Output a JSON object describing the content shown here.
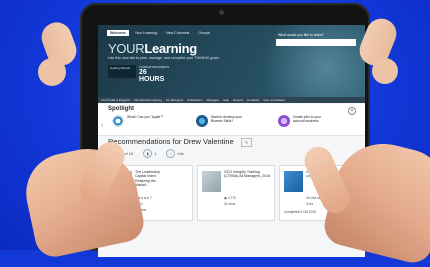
{
  "nav_tabs": [
    "Welcome",
    "Your Learning",
    "New Channels",
    "Groups"
  ],
  "logo_prefix": "YOUR",
  "logo_suffix": "Learning",
  "tagline": "Use this new site to plan, manage, and complete your THINK40 goals.",
  "stat_box": "Getting Started",
  "stat_label": "THINK40 PROGRESS",
  "stat_value": "26 HOURS",
  "search_label": "What would you like to learn?",
  "search_placeholder": "",
  "subnav": [
    "Your Profile & Progress",
    "Self-Directed Learning",
    "For Managers",
    "Notifications",
    "Messages",
    "Help",
    "Mentors",
    "Feedback",
    "Give us feedback"
  ],
  "spotlight": {
    "title": "Spotlight",
    "items": [
      {
        "text": "What? Can you \"Apple\"?"
      },
      {
        "text": "Want to develop your Bluemix Skills?"
      },
      {
        "text": "Create jobs to your account business"
      }
    ]
  },
  "recommendations_title": "Recommendations for Drew Valentine",
  "reco_edit": "✎",
  "filters": [
    {
      "icon": "✓",
      "label": "1 of 10"
    },
    {
      "icon": "▮",
      "label": "1"
    },
    {
      "icon": "i",
      "label": "Info"
    }
  ],
  "cards": [
    {
      "title": "The Leadership Capital Index: Realizing the Market...",
      "rating": "★★★★★ 7",
      "meta1": "▣ 10",
      "meta2": "30 mins"
    },
    {
      "title": "GCG Integrity Training (CTEBA) All Managers_2016",
      "rating": "",
      "meta1": "▣ 4,770",
      "meta2": "31 mins"
    },
    {
      "title": "Interview the IBM Way self paced learning",
      "rating": "",
      "meta1": "On-line self study",
      "meta2": "3 hrs",
      "meta3": "Completed 9 Oct 2015"
    }
  ]
}
